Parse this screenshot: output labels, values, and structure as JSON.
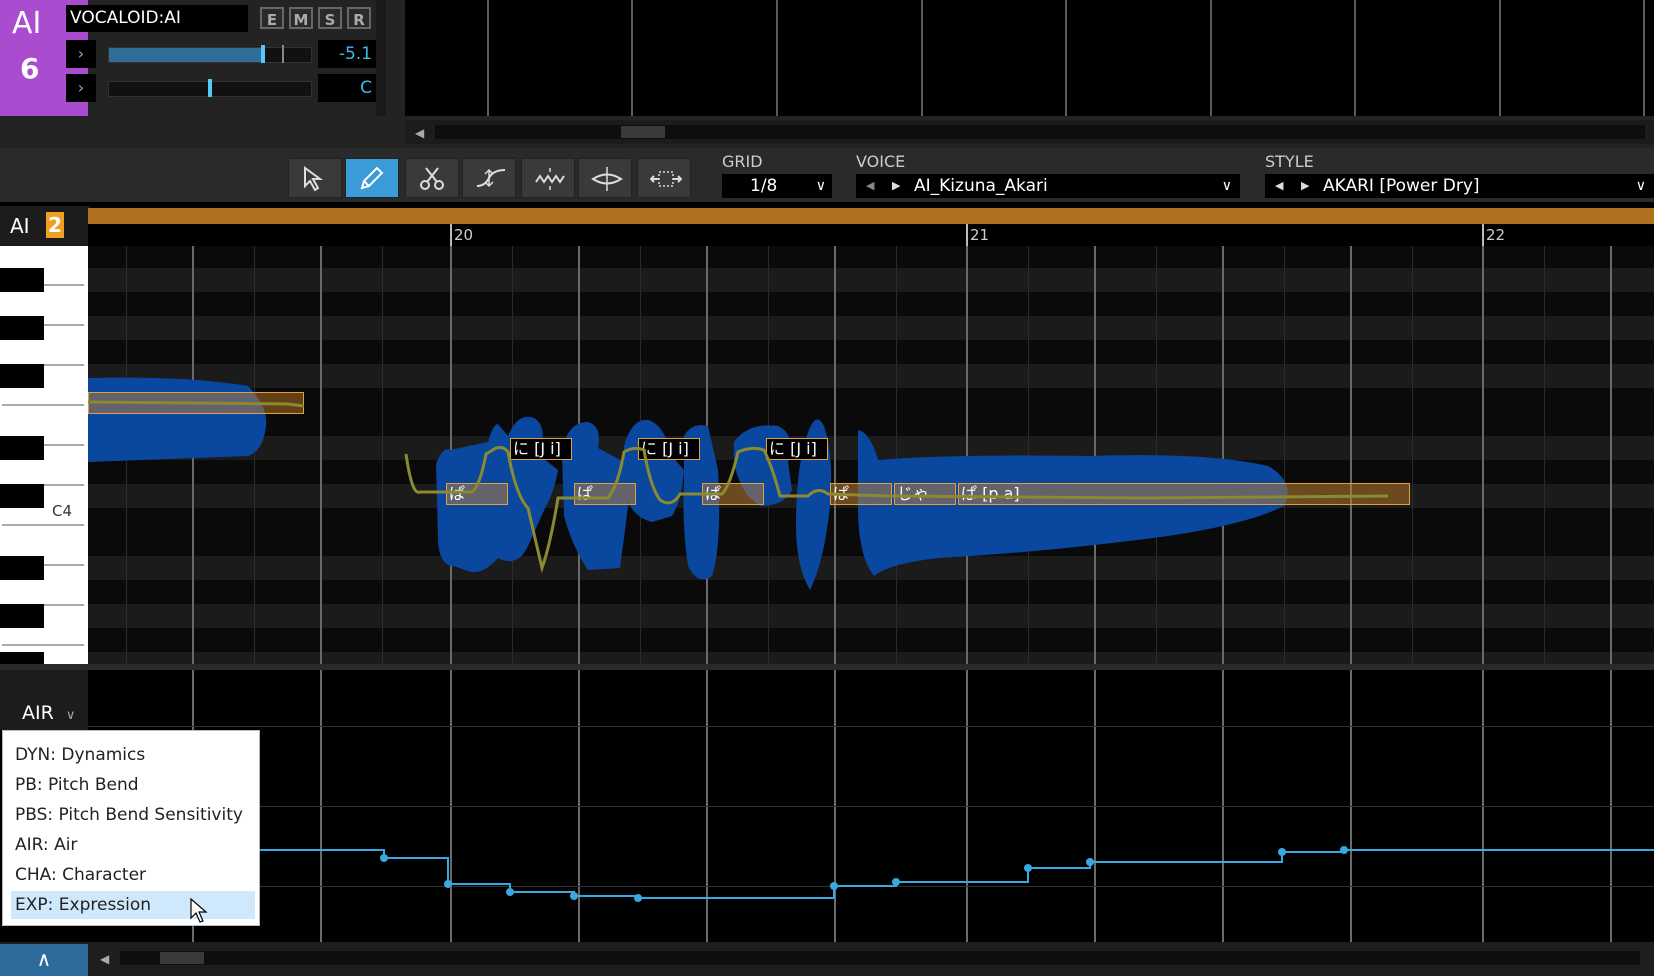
{
  "track": {
    "badge_ai": "AI",
    "badge_number": "6",
    "name": "VOCALOID:AI",
    "buttons": [
      "E",
      "M",
      "S",
      "R"
    ],
    "volume_value": "-5.1",
    "pan_value": "C",
    "volume_level": 0.76,
    "pan_level": 0.5
  },
  "toolbar": {
    "grid_label": "GRID",
    "grid_value": "1/8",
    "voice_label": "VOICE",
    "voice_value": "AI_Kizuna_Akari",
    "style_label": "STYLE",
    "style_value": "AKARI [Power Dry]"
  },
  "editor": {
    "track_ai": "AI",
    "track_number": "2",
    "ruler": [
      "20",
      "21",
      "22"
    ],
    "key_label": "C4"
  },
  "notes": [
    {
      "lyric": "ぱ",
      "phoneme": ""
    },
    {
      "lyric": "ぱ",
      "phoneme": "に [J i]"
    },
    {
      "lyric": "ぱ",
      "phoneme": "に [J i]"
    },
    {
      "lyric": "ぱ",
      "phoneme": "に [J i]"
    },
    {
      "lyric": "じゃ",
      "phoneme": ""
    },
    {
      "lyric": "ぱ [p a]",
      "phoneme": ""
    }
  ],
  "param": {
    "current": "AIR",
    "menu": [
      {
        "label": "DYN: Dynamics"
      },
      {
        "label": "PB: Pitch Bend"
      },
      {
        "label": "PBS: Pitch Bend Sensitivity"
      },
      {
        "label": "AIR: Air"
      },
      {
        "label": "CHA: Character"
      },
      {
        "label": "EXP: Expression"
      }
    ],
    "highlighted": "EXP: Expression"
  },
  "colors": {
    "track_purple": "#a94cd0",
    "accent_blue": "#3a9bd6",
    "note_orange": "#e0a040",
    "waveform_blue": "#0a48a0",
    "pitch_curve": "#8a8a30",
    "param_line": "#3aa8e0"
  }
}
